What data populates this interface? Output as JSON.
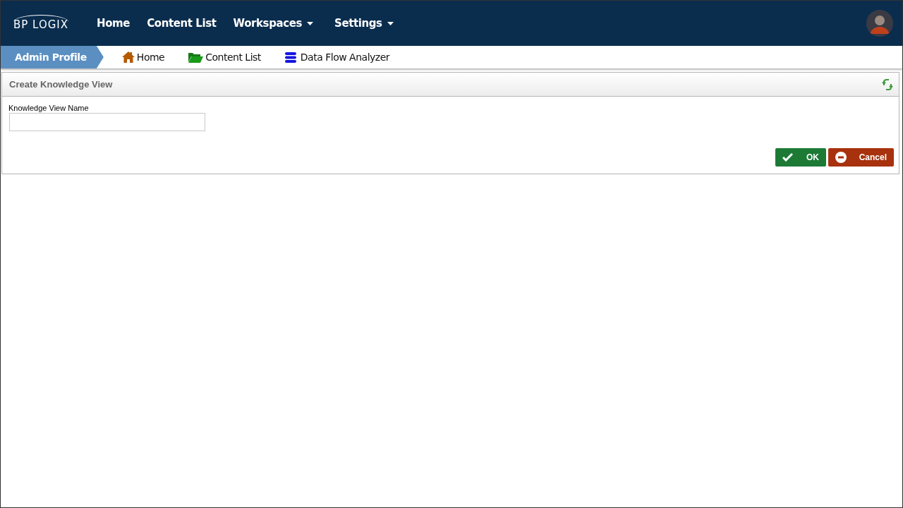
{
  "logo": "BP LOGIX",
  "nav": [
    {
      "label": "Home",
      "dropdown": false
    },
    {
      "label": "Content List",
      "dropdown": false
    },
    {
      "label": "Workspaces",
      "dropdown": true
    },
    {
      "label": "Settings",
      "dropdown": true
    }
  ],
  "breadcrumb": {
    "current": "Admin Profile",
    "links": [
      {
        "label": "Home",
        "kind": "house"
      },
      {
        "label": "Content List",
        "kind": "folder"
      },
      {
        "label": "Data Flow Analyzer",
        "kind": "database"
      }
    ]
  },
  "panel": {
    "title": "Create Knowledge View",
    "field": {
      "label": "Knowledge View Name"
    },
    "buttons": [
      {
        "label": "OK",
        "kind": "ok"
      },
      {
        "label": "Cancel",
        "kind": "cancel"
      }
    ]
  }
}
